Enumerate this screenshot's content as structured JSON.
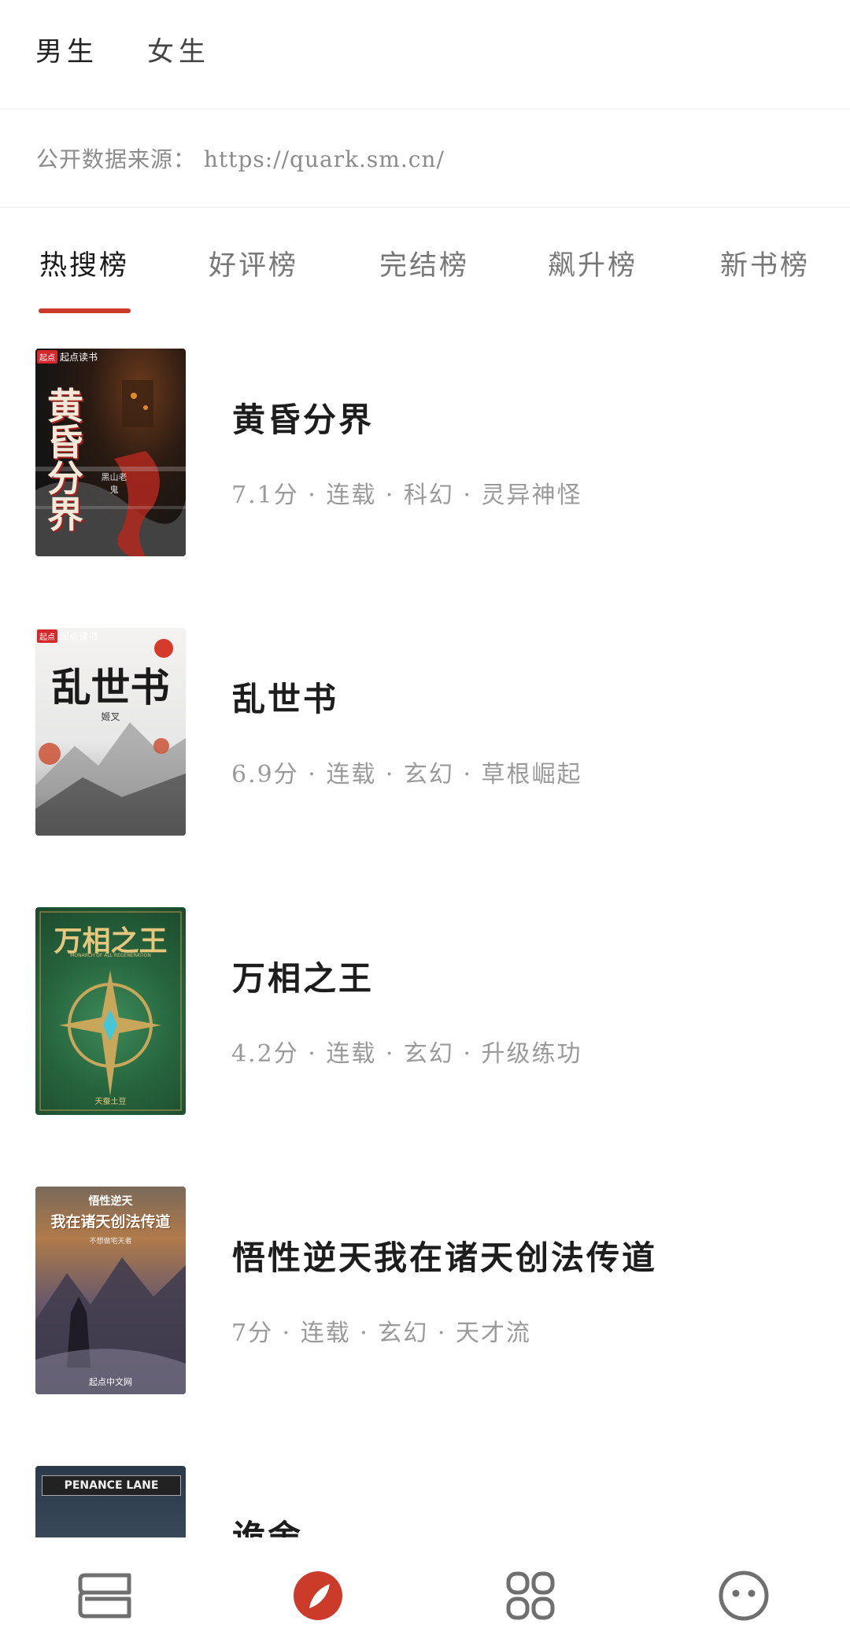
{
  "gender_tabs": [
    {
      "label": "男生",
      "active": true
    },
    {
      "label": "女生",
      "active": false
    }
  ],
  "source": {
    "text": "公开数据来源： https://quark.sm.cn/"
  },
  "rank_tabs": [
    {
      "label": "热搜榜",
      "active": true
    },
    {
      "label": "好评榜",
      "active": false
    },
    {
      "label": "完结榜",
      "active": false
    },
    {
      "label": "飙升榜",
      "active": false
    },
    {
      "label": "新书榜",
      "active": false
    }
  ],
  "books": [
    {
      "title": "黄昏分界",
      "meta": "7.1分 · 连载 · 科幻 · 灵异神怪",
      "cover": {
        "badge": "起点读书",
        "badge_icon": "起点",
        "title": "黄昏分界",
        "subtitle": "黑山老鬼"
      }
    },
    {
      "title": "乱世书",
      "meta": "6.9分 · 连载 · 玄幻 · 草根崛起",
      "cover": {
        "badge": "起点读书",
        "badge_icon": "起点",
        "title": "乱世书",
        "subtitle": "姬叉"
      }
    },
    {
      "title": "万相之王",
      "meta": "4.2分 · 连载 · 玄幻 · 升级练功",
      "cover": {
        "title": "万相之王",
        "tagline": "MONARCH OF ALL REGENERATION",
        "subtitle": "天蚕土豆"
      }
    },
    {
      "title": "悟性逆天我在诸天创法传道",
      "meta": "7分 · 连载 · 玄幻 · 天才流",
      "cover": {
        "title_top": "悟性逆天",
        "title": "我在诸天创法传道",
        "author": "不想做宅天者",
        "publisher": "起点中文网"
      }
    },
    {
      "title": "诡舍",
      "meta": "",
      "cover": {
        "title": "PENANCE LANE"
      }
    }
  ],
  "colors": {
    "accent": "#cc3b2a",
    "nav_icon": "#6f6f6f"
  },
  "bottom_nav": [
    {
      "icon": "bookshelf-icon",
      "active": false
    },
    {
      "icon": "compass-icon",
      "active": true
    },
    {
      "icon": "apps-icon",
      "active": false
    },
    {
      "icon": "profile-face-icon",
      "active": false
    }
  ]
}
